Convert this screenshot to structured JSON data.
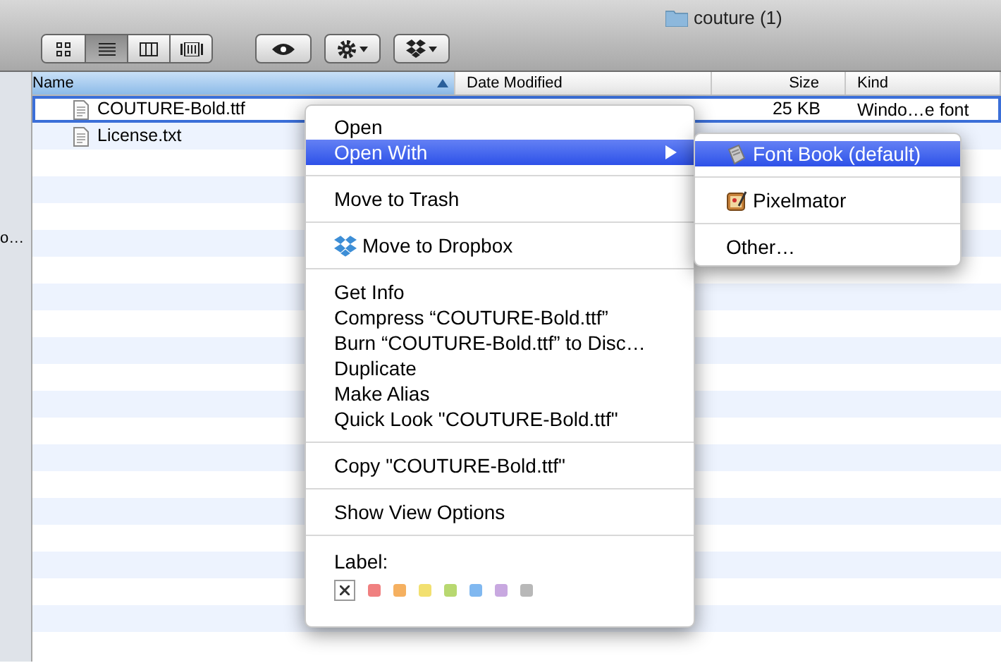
{
  "window": {
    "title": "couture (1)"
  },
  "toolbar": {
    "view_buttons": [
      {
        "kind": "icon",
        "selected": false
      },
      {
        "kind": "list",
        "selected": true
      },
      {
        "kind": "columns",
        "selected": false
      },
      {
        "kind": "coverflow",
        "selected": false
      }
    ]
  },
  "sidebar": {
    "items": [
      "o…"
    ]
  },
  "table": {
    "columns": [
      {
        "label": "Name",
        "sorted": true
      },
      {
        "label": "Date Modified",
        "sorted": false
      },
      {
        "label": "Size",
        "sorted": false
      },
      {
        "label": "Kind",
        "sorted": false
      }
    ],
    "rows": [
      {
        "name": "COUTURE-Bold.ttf",
        "size": "25 KB",
        "kind": "Windo…e font",
        "selected": true
      },
      {
        "name": "License.txt",
        "selected": false
      }
    ]
  },
  "context_menu": {
    "items": [
      {
        "kind": "item",
        "label": "Open",
        "selected": false
      },
      {
        "kind": "item",
        "label": "Open With",
        "selected": true,
        "submenu": true
      },
      {
        "kind": "separator"
      },
      {
        "kind": "item",
        "label": "Move to Trash",
        "selected": false
      },
      {
        "kind": "separator"
      },
      {
        "kind": "item",
        "label": "Move to Dropbox",
        "selected": false
      },
      {
        "kind": "separator"
      },
      {
        "kind": "item",
        "label": "Get Info",
        "selected": false
      },
      {
        "kind": "item",
        "label": "Compress “COUTURE-Bold.ttf”",
        "selected": false
      },
      {
        "kind": "item",
        "label": "Burn “COUTURE-Bold.ttf” to Disc…",
        "selected": false
      },
      {
        "kind": "item",
        "label": "Duplicate",
        "selected": false
      },
      {
        "kind": "item",
        "label": "Make Alias",
        "selected": false
      },
      {
        "kind": "item",
        "label": "Quick Look \"COUTURE-Bold.ttf\"",
        "selected": false
      },
      {
        "kind": "separator"
      },
      {
        "kind": "item",
        "label": "Copy \"COUTURE-Bold.ttf\"",
        "selected": false
      },
      {
        "kind": "separator"
      },
      {
        "kind": "item",
        "label": "Show View Options",
        "selected": false
      },
      {
        "kind": "separator"
      },
      {
        "kind": "labels",
        "label": "Label:",
        "swatches": [
          {
            "color": "#f08080"
          },
          {
            "color": "#f5b060"
          },
          {
            "color": "#f2e070"
          },
          {
            "color": "#b8d870"
          },
          {
            "color": "#80b8f0"
          },
          {
            "color": "#c8a8e0"
          },
          {
            "color": "#b8b8b8"
          }
        ]
      }
    ]
  },
  "submenu": {
    "items": [
      {
        "kind": "item",
        "label": "Font Book (default)",
        "selected": true
      },
      {
        "kind": "separator"
      },
      {
        "kind": "item",
        "label": "Pixelmator",
        "selected": false
      },
      {
        "kind": "separator"
      },
      {
        "kind": "item",
        "label": "Other…",
        "selected": false
      }
    ]
  }
}
